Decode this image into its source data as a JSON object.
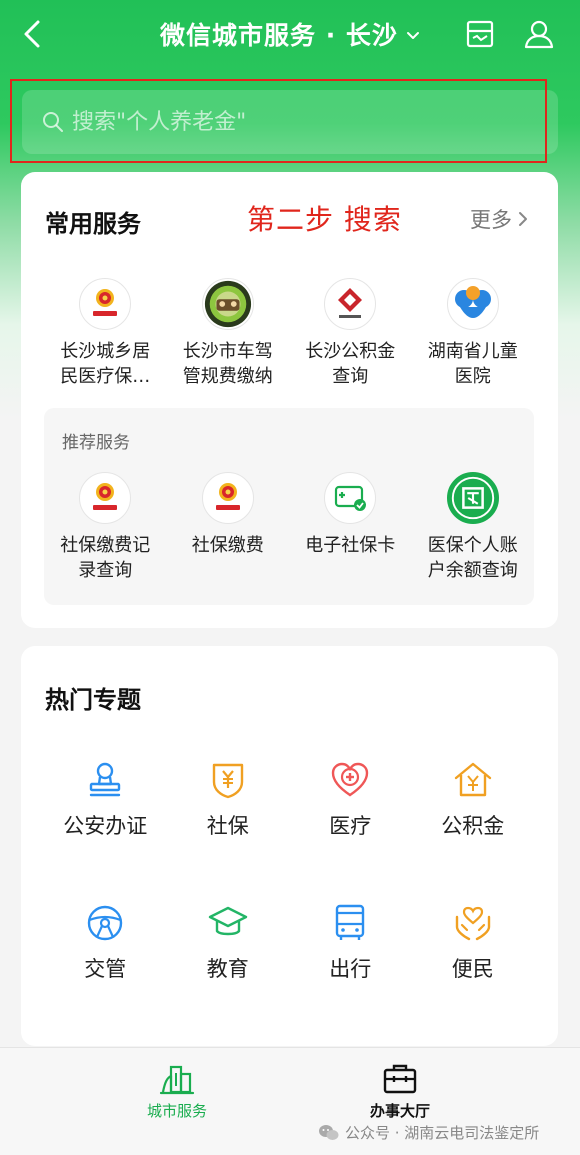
{
  "header": {
    "title": "微信城市服务 · 长沙",
    "back_icon": "chevron-left-icon",
    "card_icon": "card-icon",
    "user_icon": "user-icon"
  },
  "search": {
    "placeholder": "搜索\"个人养老金\""
  },
  "annotation": "第二步  搜索",
  "common_services": {
    "title": "常用服务",
    "more_label": "更多",
    "items": [
      {
        "label": "长沙城乡居民医疗保…",
        "icon": "social-security-emblem-icon"
      },
      {
        "label": "长沙市车驾管规费缴纳",
        "icon": "traffic-police-emblem-icon"
      },
      {
        "label": "长沙公积金查询",
        "icon": "housing-fund-logo-icon"
      },
      {
        "label": "湖南省儿童医院",
        "icon": "childrens-hospital-logo-icon"
      }
    ]
  },
  "recommended": {
    "title": "推荐服务",
    "items": [
      {
        "label": "社保缴费记录查询",
        "icon": "social-security-emblem-icon"
      },
      {
        "label": "社保缴费",
        "icon": "social-security-emblem-icon"
      },
      {
        "label": "电子社保卡",
        "icon": "e-social-card-icon"
      },
      {
        "label": "医保个人账户余额查询",
        "icon": "medical-insurance-icon"
      }
    ]
  },
  "hot_topics": {
    "title": "热门专题",
    "items": [
      {
        "label": "公安办证",
        "icon": "police-stamp-icon"
      },
      {
        "label": "社保",
        "icon": "social-insurance-shield-icon"
      },
      {
        "label": "医疗",
        "icon": "medical-cross-icon"
      },
      {
        "label": "公积金",
        "icon": "housing-fund-house-icon"
      },
      {
        "label": "交管",
        "icon": "steering-wheel-icon"
      },
      {
        "label": "教育",
        "icon": "graduation-cap-icon"
      },
      {
        "label": "出行",
        "icon": "bus-icon"
      },
      {
        "label": "便民",
        "icon": "heart-hands-icon"
      }
    ]
  },
  "bottom_nav": {
    "items": [
      {
        "label": "城市服务",
        "icon": "city-buildings-icon",
        "active": true
      },
      {
        "label": "办事大厅",
        "icon": "briefcase-icon",
        "active": false
      }
    ]
  },
  "watermark": "公众号 · 湖南云电司法鉴定所",
  "colors": {
    "brand_green": "#21c057",
    "annotation_red": "#e0261c",
    "hot_icon_blue": "#2b8ff0",
    "hot_icon_orange": "#f0a022",
    "hot_icon_red": "#ef5757",
    "hot_icon_green": "#23b566",
    "nav_active": "#1aad4f"
  }
}
